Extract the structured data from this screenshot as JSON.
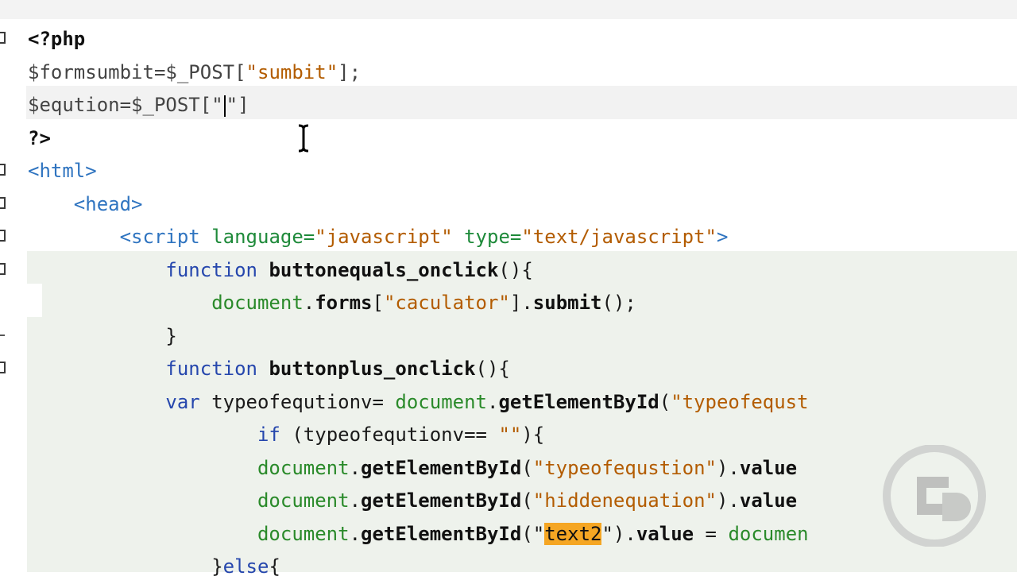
{
  "editor": {
    "lines": [
      [
        {
          "t": "<?php",
          "c": "php-tag"
        }
      ],
      [
        {
          "t": "$formsumbit=$_POST[",
          "c": "php-var"
        },
        {
          "t": "\"sumbit\"",
          "c": "php-str"
        },
        {
          "t": "];",
          "c": "php-var"
        }
      ],
      [
        {
          "t": "$eqution=$_POST[\"",
          "c": "php-var"
        },
        {
          "caret": true
        },
        {
          "t": "\"]",
          "c": "php-var"
        }
      ],
      [
        {
          "t": "?>",
          "c": "php-tag"
        }
      ],
      [
        {
          "t": "<html>",
          "c": "html-tag"
        }
      ],
      [
        {
          "t": "    "
        },
        {
          "t": "<head>",
          "c": "html-tag"
        }
      ],
      [
        {
          "t": "        "
        },
        {
          "t": "<script",
          "c": "html-tag"
        },
        {
          "t": " "
        },
        {
          "t": "language=",
          "c": "attr"
        },
        {
          "t": "\"javascript\"",
          "c": "attr-val"
        },
        {
          "t": " "
        },
        {
          "t": "type=",
          "c": "attr"
        },
        {
          "t": "\"text/javascript\"",
          "c": "attr-val"
        },
        {
          "t": ">",
          "c": "html-tag"
        }
      ],
      [
        {
          "t": "            "
        },
        {
          "t": "function",
          "c": "kw"
        },
        {
          "t": " "
        },
        {
          "t": "buttonequals_onclick",
          "c": "fn"
        },
        {
          "t": "(){"
        }
      ],
      [
        {
          "t": "                "
        },
        {
          "t": "document",
          "c": "js-obj"
        },
        {
          "t": "."
        },
        {
          "t": "forms",
          "c": "fn"
        },
        {
          "t": "["
        },
        {
          "t": "\"caculator\"",
          "c": "js-str"
        },
        {
          "t": "]."
        },
        {
          "t": "submit",
          "c": "fn"
        },
        {
          "t": "();"
        }
      ],
      [
        {
          "t": "            }"
        }
      ],
      [
        {
          "t": "            "
        },
        {
          "t": "function",
          "c": "kw"
        },
        {
          "t": " "
        },
        {
          "t": "buttonplus_onclick",
          "c": "fn"
        },
        {
          "t": "(){"
        }
      ],
      [
        {
          "t": "            "
        },
        {
          "t": "var",
          "c": "kw"
        },
        {
          "t": " typeofequtionv= "
        },
        {
          "t": "document",
          "c": "js-obj"
        },
        {
          "t": "."
        },
        {
          "t": "getElementById",
          "c": "fn"
        },
        {
          "t": "("
        },
        {
          "t": "\"typeofequst",
          "c": "js-str"
        }
      ],
      [
        {
          "t": "                    "
        },
        {
          "t": "if",
          "c": "kw"
        },
        {
          "t": " (typeofequtionv== "
        },
        {
          "t": "\"\"",
          "c": "js-str"
        },
        {
          "t": "){"
        }
      ],
      [
        {
          "t": "                    "
        },
        {
          "t": "document",
          "c": "js-obj"
        },
        {
          "t": "."
        },
        {
          "t": "getElementById",
          "c": "fn"
        },
        {
          "t": "("
        },
        {
          "t": "\"typeofequstion\"",
          "c": "js-str"
        },
        {
          "t": ")."
        },
        {
          "t": "value",
          "c": "fn"
        }
      ],
      [
        {
          "t": "                    "
        },
        {
          "t": "document",
          "c": "js-obj"
        },
        {
          "t": "."
        },
        {
          "t": "getElementById",
          "c": "fn"
        },
        {
          "t": "("
        },
        {
          "t": "\"hiddenequation\"",
          "c": "js-str"
        },
        {
          "t": ")."
        },
        {
          "t": "value",
          "c": "fn"
        }
      ],
      [
        {
          "t": "                    "
        },
        {
          "t": "document",
          "c": "js-obj"
        },
        {
          "t": "."
        },
        {
          "t": "getElementById",
          "c": "fn"
        },
        {
          "t": "(\""
        },
        {
          "t": "text2",
          "c": "hl-word"
        },
        {
          "t": "\")."
        },
        {
          "t": "value",
          "c": "fn"
        },
        {
          "t": " = "
        },
        {
          "t": "documen",
          "c": "js-obj"
        }
      ],
      [
        {
          "t": "                }"
        },
        {
          "t": "else",
          "c": "kw"
        },
        {
          "t": "{"
        }
      ]
    ]
  },
  "colors": {
    "highlight_word": "#f5a623",
    "js_block_background": "#eef2ec",
    "current_line": "#f2f2f2"
  },
  "icons": {
    "cursor": "ibeam-cursor-icon",
    "watermark": "channel-logo-icon"
  }
}
